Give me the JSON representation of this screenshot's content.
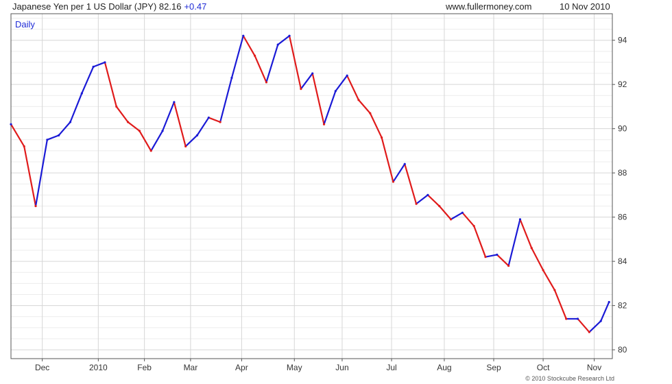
{
  "header": {
    "title": "Japanese Yen per 1 US Dollar (JPY) 82.16",
    "change": "+0.47",
    "site": "www.fullermoney.com",
    "date": "10 Nov 2010"
  },
  "footer": {
    "copyright": "© 2010 Stockcube Research Ltd"
  },
  "colors": {
    "up": "#1a1ad6",
    "down": "#e01b1b",
    "grid": "#d6d6d6",
    "grid_minor": "#ececec",
    "axis": "#555555"
  },
  "chart_data": {
    "type": "line",
    "title": "Japanese Yen per 1 US Dollar (JPY)",
    "period_label": "Daily",
    "xlabel": "",
    "ylabel": "",
    "y_axis_side": "right",
    "ylim": [
      79.6,
      95.2
    ],
    "yticks": [
      80,
      82,
      84,
      86,
      88,
      90,
      92,
      94
    ],
    "x_tick_labels": [
      "Dec",
      "2010",
      "Feb",
      "Mar",
      "Apr",
      "May",
      "Jun",
      "Jul",
      "Aug",
      "Sep",
      "Oct",
      "Nov"
    ],
    "x_tick_dates": [
      "2009-12-01",
      "2010-01-04",
      "2010-02-01",
      "2010-03-01",
      "2010-04-01",
      "2010-05-03",
      "2010-06-01",
      "2010-07-01",
      "2010-08-02",
      "2010-09-01",
      "2010-10-01",
      "2010-11-01"
    ],
    "x_start": "2009-11-12",
    "x_end": "2010-11-12",
    "grid": true,
    "series": [
      {
        "name": "JPY",
        "x": [
          "2009-11-12",
          "2009-11-20",
          "2009-11-27",
          "2009-12-04",
          "2009-12-11",
          "2009-12-18",
          "2009-12-25",
          "2010-01-01",
          "2010-01-08",
          "2010-01-15",
          "2010-01-22",
          "2010-01-29",
          "2010-02-05",
          "2010-02-12",
          "2010-02-19",
          "2010-02-26",
          "2010-03-05",
          "2010-03-12",
          "2010-03-19",
          "2010-03-26",
          "2010-04-02",
          "2010-04-09",
          "2010-04-16",
          "2010-04-23",
          "2010-04-30",
          "2010-05-07",
          "2010-05-14",
          "2010-05-21",
          "2010-05-28",
          "2010-06-04",
          "2010-06-11",
          "2010-06-18",
          "2010-06-25",
          "2010-07-02",
          "2010-07-09",
          "2010-07-16",
          "2010-07-23",
          "2010-07-30",
          "2010-08-06",
          "2010-08-13",
          "2010-08-20",
          "2010-08-27",
          "2010-09-03",
          "2010-09-10",
          "2010-09-17",
          "2010-09-24",
          "2010-10-01",
          "2010-10-08",
          "2010-10-15",
          "2010-10-22",
          "2010-10-29",
          "2010-11-05",
          "2010-11-10"
        ],
        "values": [
          90.2,
          89.2,
          86.5,
          89.5,
          89.7,
          90.3,
          91.6,
          92.8,
          93.0,
          91.0,
          90.3,
          89.9,
          89.0,
          89.9,
          91.2,
          89.2,
          89.7,
          90.5,
          90.3,
          92.3,
          94.2,
          93.3,
          92.1,
          93.8,
          94.2,
          91.8,
          92.5,
          90.2,
          91.7,
          92.4,
          91.3,
          90.7,
          89.6,
          87.6,
          88.4,
          86.6,
          87.0,
          86.5,
          85.9,
          86.2,
          85.6,
          84.2,
          84.3,
          83.8,
          85.9,
          84.6,
          83.6,
          82.7,
          81.4,
          81.4,
          80.8,
          81.3,
          82.16
        ]
      }
    ]
  }
}
